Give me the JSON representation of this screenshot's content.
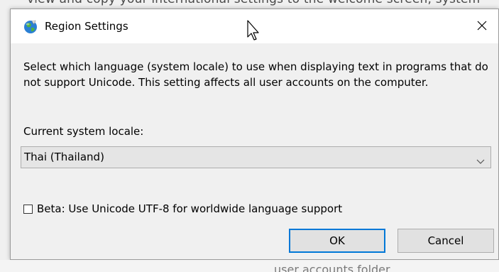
{
  "background": {
    "top_text": "view and copy your international settings to the welcome screen, system",
    "bottom_text": "user accounts folder"
  },
  "dialog": {
    "title": "Region Settings",
    "icon": "globe-region-icon",
    "close_icon": "close-icon",
    "description": "Select which language (system locale) to use when displaying text in programs that do not support Unicode. This setting affects all user accounts on the computer.",
    "locale_label": "Current system locale:",
    "locale_select": {
      "value": "Thai (Thailand)",
      "chevron_icon": "chevron-down-icon"
    },
    "beta_checkbox": {
      "label": "Beta: Use Unicode UTF-8 for worldwide language support",
      "checked": false
    },
    "buttons": {
      "ok_label": "OK",
      "cancel_label": "Cancel"
    }
  },
  "colors": {
    "accent": "#0078d7",
    "dialog_background": "#f0f0f0",
    "titlebar_background": "#ffffff",
    "button_background": "#e1e1e1",
    "select_background": "#e5e5e5"
  }
}
